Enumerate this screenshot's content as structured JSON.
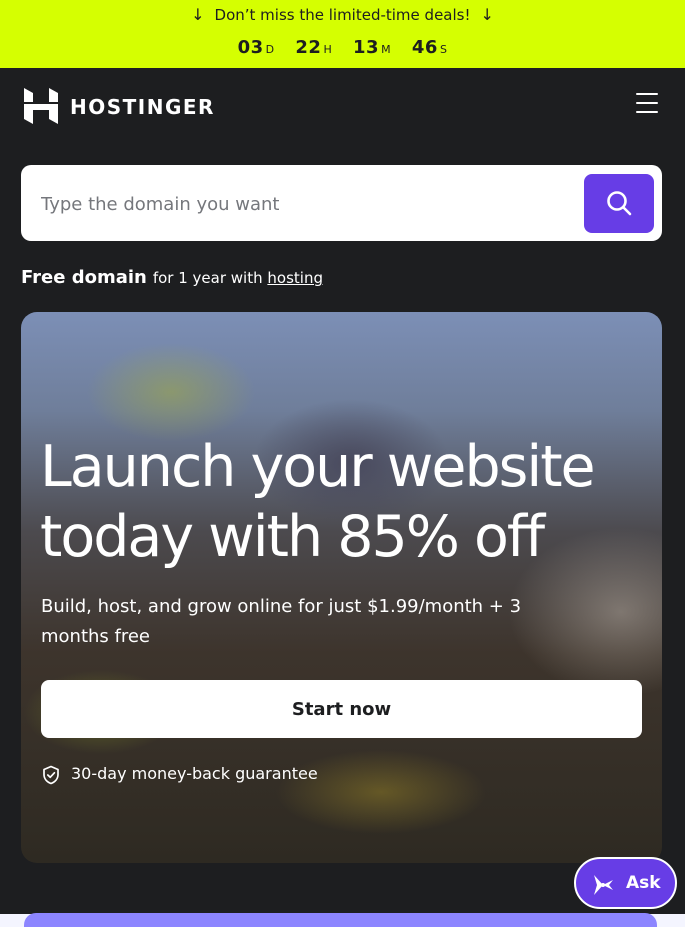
{
  "promo": {
    "message": "Don’t miss the limited-time deals!",
    "arrow": "↓",
    "countdown": [
      {
        "value": "03",
        "unit": "D"
      },
      {
        "value": "22",
        "unit": "H"
      },
      {
        "value": "13",
        "unit": "M"
      },
      {
        "value": "46",
        "unit": "S"
      }
    ]
  },
  "header": {
    "brand": "HOSTINGER",
    "logo_icon": "hostinger-logo",
    "menu_icon": "hamburger-menu-icon"
  },
  "search": {
    "placeholder": "Type the domain you want",
    "value": "",
    "button_icon": "search-icon"
  },
  "free_domain": {
    "bold": "Free domain",
    "text": "for 1 year with",
    "link": "hosting"
  },
  "hero": {
    "title_line1": "Launch your website",
    "title_line2": "today with 85% off",
    "subtitle": "Build, host, and grow online for just $1.99/month + 3 months free",
    "cta": "Start now",
    "guarantee": "30-day money-back guarantee",
    "guarantee_icon": "shield-check-icon"
  },
  "ask": {
    "label": "Ask",
    "icon": "sparkle-icon"
  },
  "colors": {
    "promo_bg": "#d5ff01",
    "header_bg": "#1d1e20",
    "accent": "#673de6",
    "text_dark": "#1d1e20"
  }
}
